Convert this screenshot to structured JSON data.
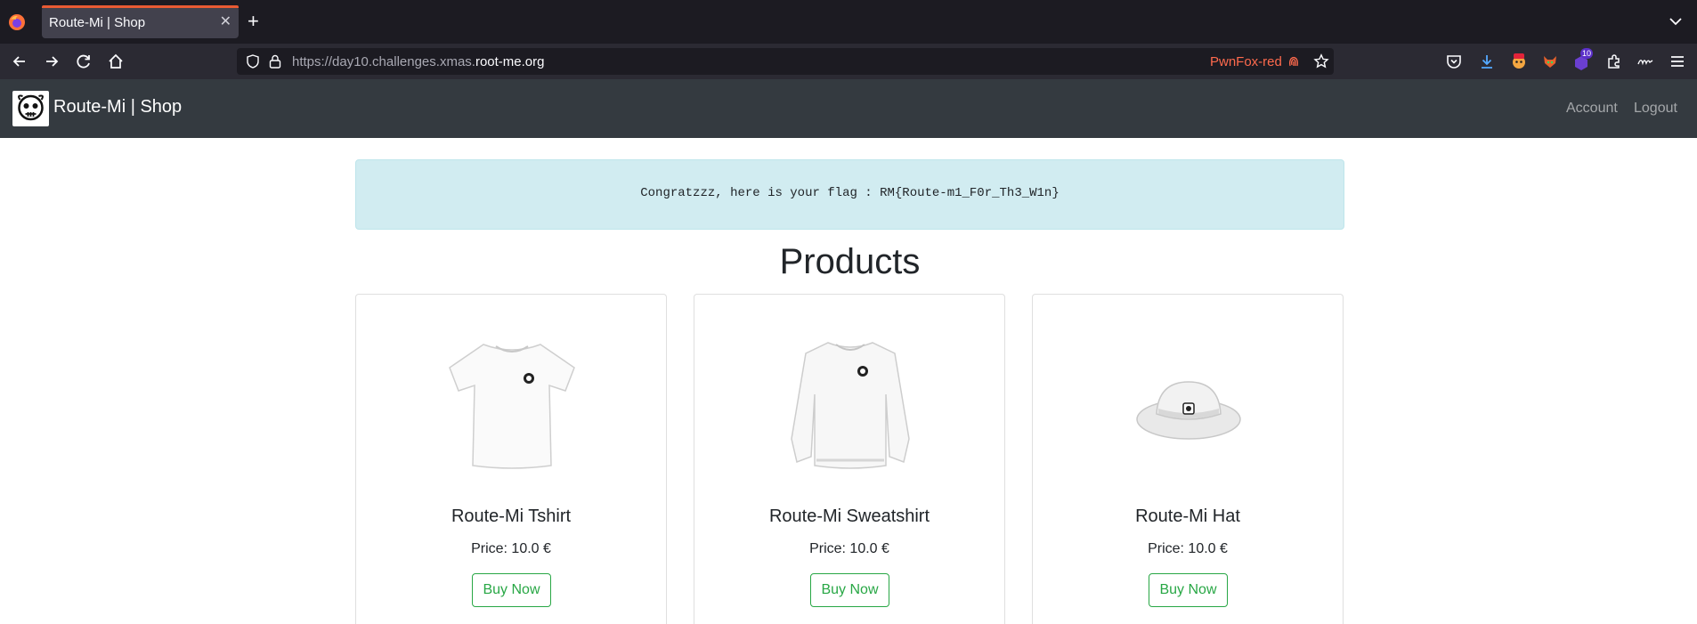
{
  "browser": {
    "tab_title": "Route-Mi | Shop",
    "url_prefix": "https://day10.challenges.xmas.",
    "url_host": "root-me.org",
    "container_label": "PwnFox-red",
    "badge_count": "10"
  },
  "site": {
    "brand": "Route-Mi | Shop",
    "nav": {
      "account": "Account",
      "logout": "Logout"
    }
  },
  "alert": {
    "message": "Congratzzz, here is your flag : RM{Route-m1_F0r_Th3_W1n}"
  },
  "products": {
    "title": "Products",
    "items": [
      {
        "name": "Route-Mi Tshirt",
        "price": "Price: 10.0 €",
        "button": "Buy Now",
        "image": "tshirt-image"
      },
      {
        "name": "Route-Mi Sweatshirt",
        "price": "Price: 10.0 €",
        "button": "Buy Now",
        "image": "sweatshirt-image"
      },
      {
        "name": "Route-Mi Hat",
        "price": "Price: 10.0 €",
        "button": "Buy Now",
        "image": "hat-image"
      }
    ]
  },
  "colors": {
    "tab_accent": "#e85a33",
    "site_nav_bg": "#343a40",
    "alert_bg": "#d1ecf1",
    "buy_button": "#28a745",
    "pwnfox_red": "#ff6a4d"
  }
}
